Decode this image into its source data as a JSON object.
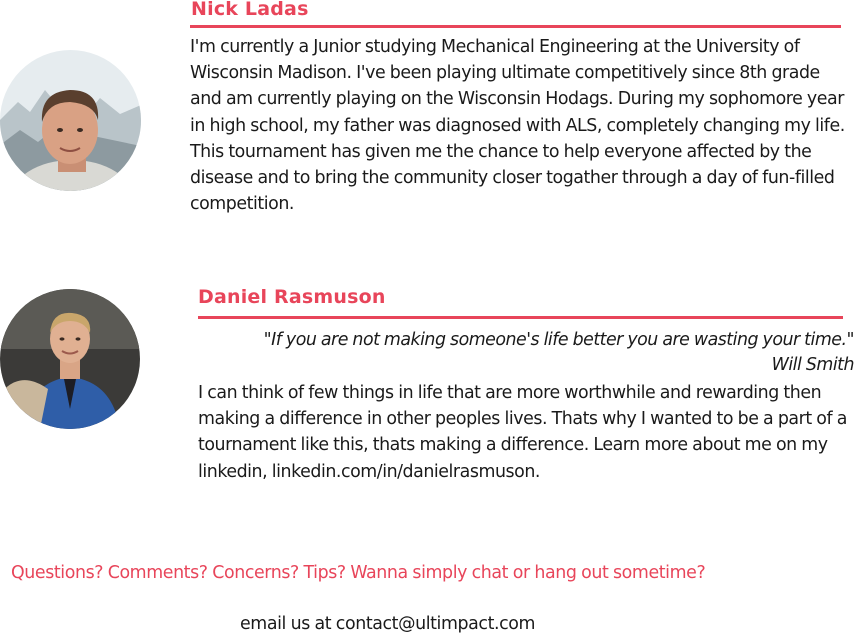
{
  "profiles": [
    {
      "name": "Nick Ladas",
      "bio": "I'm currently a Junior studying Mechanical Engineering at the University of Wisconsin Madison.  I've been playing ultimate competitively since 8th grade and am currently playing on the Wisconsin Hodags.  During my sophomore year in high school, my father was diagnosed with ALS, completely changing my life.  This tournament has given me the chance to help everyone affected by the disease and to bring the community closer togather through a day of fun-filled competition."
    },
    {
      "name": "Daniel Rasmuson",
      "quote": "\"If you are not making someone's life better you are wasting your time.\"",
      "quote_author": "Will Smith",
      "bio": "I can think of few things in life that are more worthwhile and rewarding then making a difference in other peoples lives. Thats why I wanted to be a part of a tournament like this, thats making a difference. Learn more about me on my linkedin, linkedin.com/in/danielrasmuson."
    }
  ],
  "contact": {
    "prompt": "Questions? Comments? Concerns? Tips? Wanna simply chat or hang out sometime?",
    "email_line": "email us at contact@ultimpact.com"
  },
  "colors": {
    "accent": "#e8455a",
    "text": "#1a1a1a",
    "background": "#ffffff"
  }
}
